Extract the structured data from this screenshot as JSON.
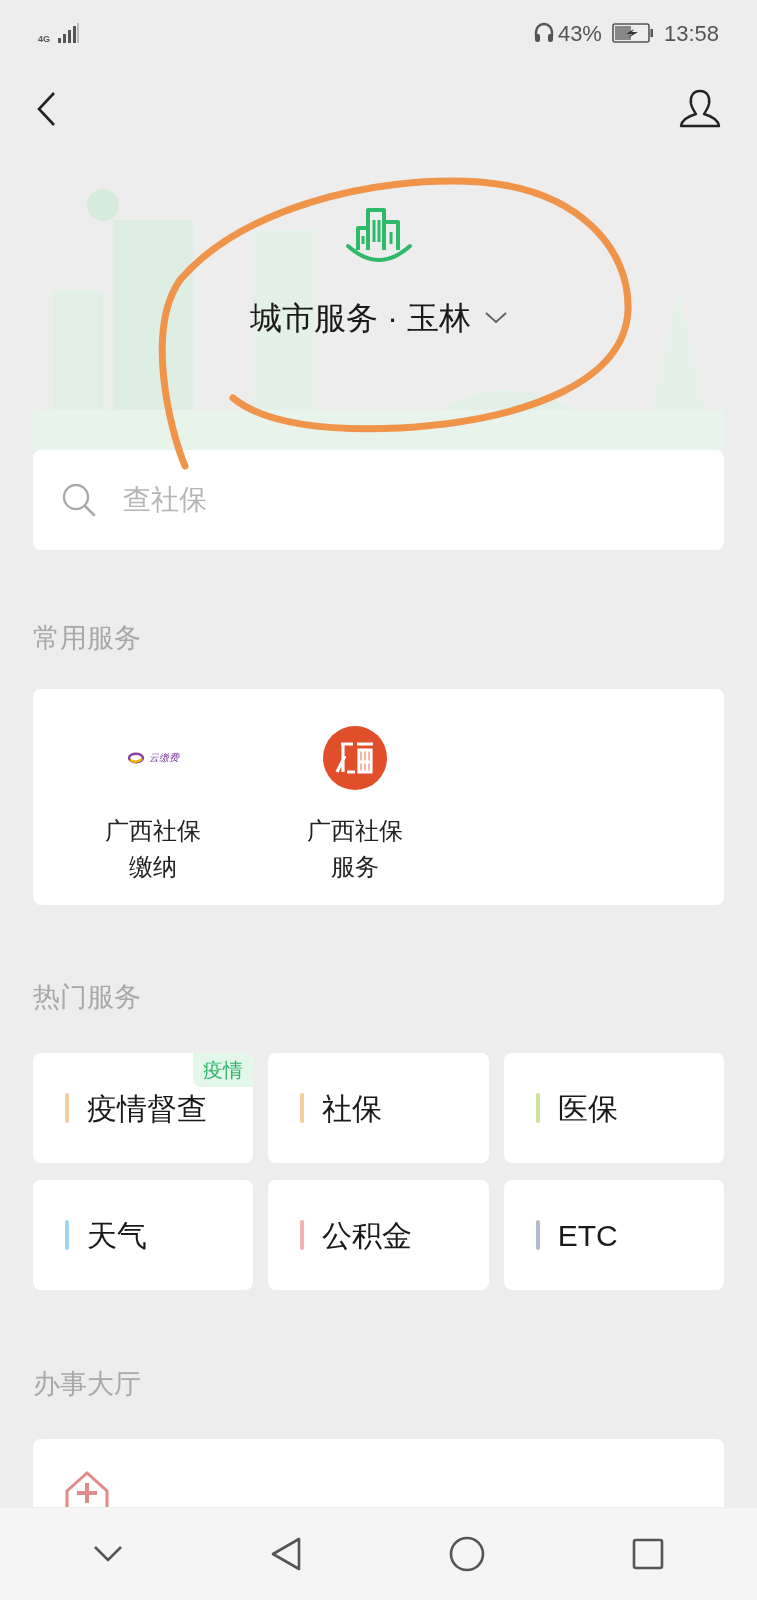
{
  "status_bar": {
    "network": "4G",
    "battery": "43%",
    "time": "13:58"
  },
  "header": {
    "title": "城市服务 · 玉林"
  },
  "search": {
    "placeholder": "查社保"
  },
  "common_services": {
    "title": "常用服务",
    "items": [
      {
        "label": "广西社保缴纳",
        "kind": "cloud-pay",
        "logo_text": "云缴费"
      },
      {
        "label": "广西社保服务",
        "kind": "round-seal"
      }
    ]
  },
  "hot_services": {
    "title": "热门服务",
    "items": [
      {
        "label": "疫情督查",
        "color": "#f2cfa0",
        "badge": "疫情"
      },
      {
        "label": "社保",
        "color": "#f2cfa0"
      },
      {
        "label": "医保",
        "color": "#cfe3a0"
      },
      {
        "label": "天气",
        "color": "#9fd4f0"
      },
      {
        "label": "公积金",
        "color": "#eeb3b3"
      },
      {
        "label": "ETC",
        "color": "#b3bccb"
      }
    ]
  },
  "service_hall": {
    "title": "办事大厅",
    "items": [
      {
        "kind": "hospital"
      }
    ]
  }
}
